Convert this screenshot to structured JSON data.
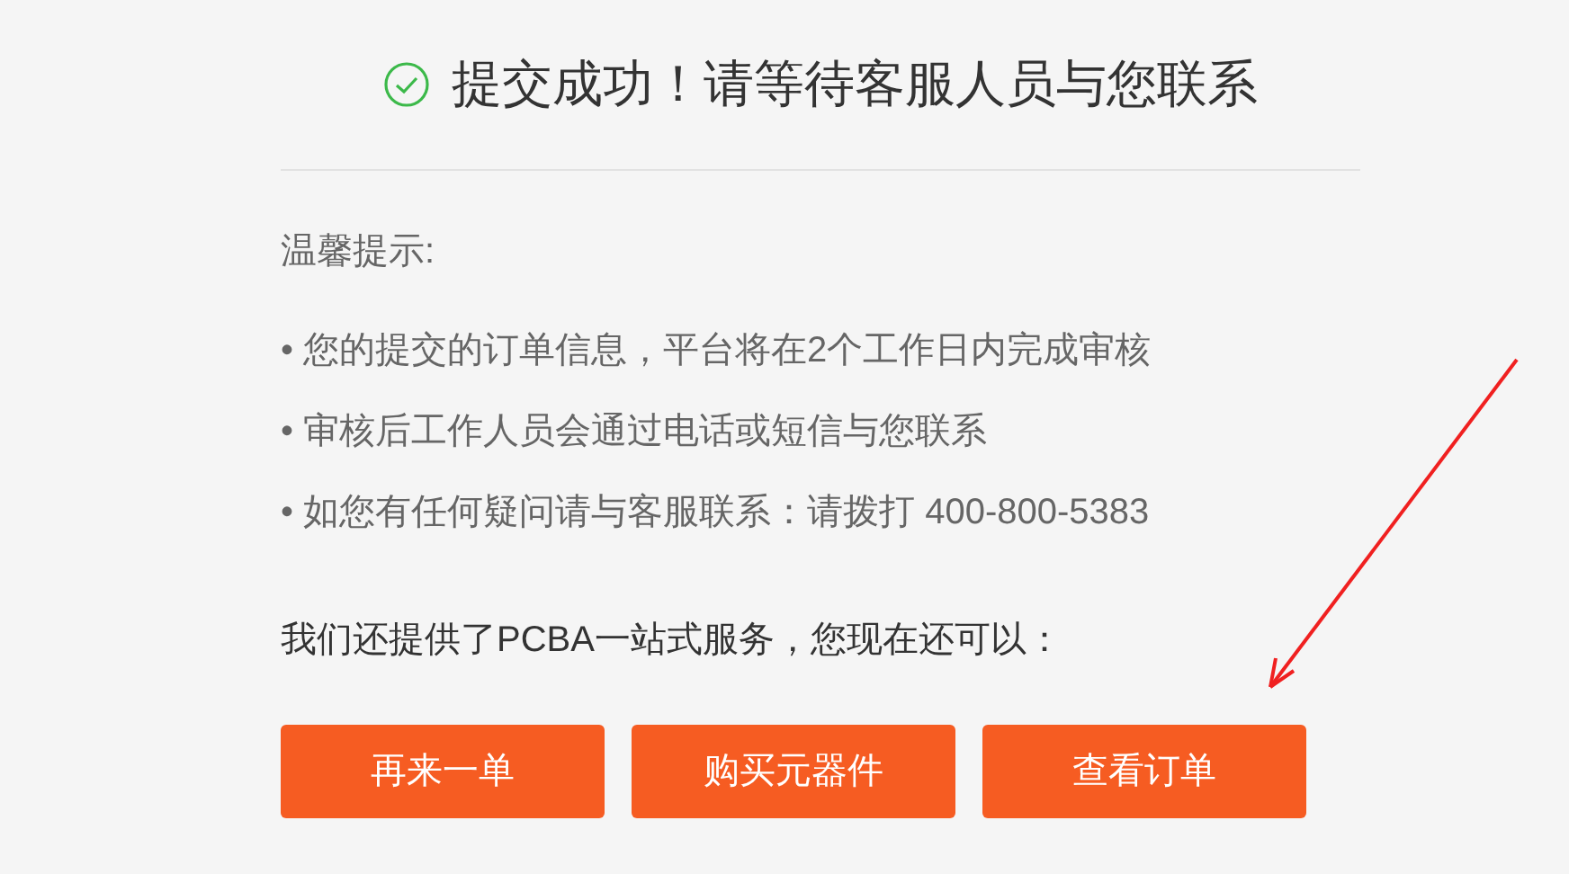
{
  "title": "提交成功！请等待客服人员与您联系",
  "tips_heading": "温馨提示:",
  "tips": [
    "• 您的提交的订单信息，平台将在2个工作日内完成审核",
    "• 审核后工作人员会通过电话或短信与您联系",
    "• 如您有任何疑问请与客服联系：请拨打 400-800-5383"
  ],
  "offer_text": "我们还提供了PCBA一站式服务，您现在还可以：",
  "buttons": [
    "再来一单",
    "购买元器件",
    "查看订单"
  ]
}
